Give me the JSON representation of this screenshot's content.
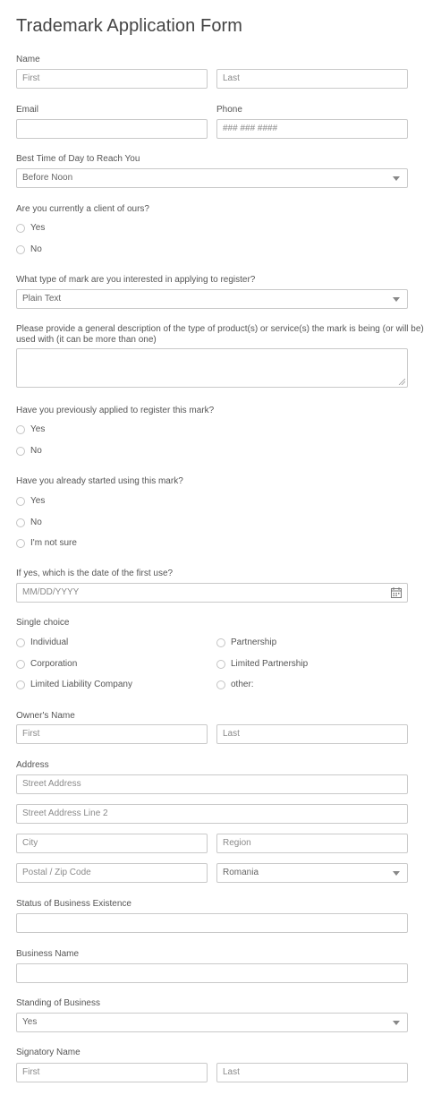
{
  "form": {
    "title": "Trademark Application Form",
    "name": {
      "label": "Name",
      "first_placeholder": "First",
      "last_placeholder": "Last"
    },
    "email": {
      "label": "Email",
      "value": ""
    },
    "phone": {
      "label": "Phone",
      "placeholder": "### ### ####"
    },
    "best_time": {
      "label": "Best Time of Day to Reach You",
      "selected": "Before Noon"
    },
    "current_client": {
      "label": "Are you currently a client of ours?",
      "options": [
        "Yes",
        "No"
      ]
    },
    "mark_type": {
      "label": "What type of mark are you interested in applying to register?",
      "selected": "Plain Text"
    },
    "description": {
      "label_line1": "Please provide a general description of the type of product(s) or service(s) the mark is being (or will be)",
      "label_line2": "used with (it can be more than one)",
      "value": ""
    },
    "previously_applied": {
      "label": "Have you previously applied to register this mark?",
      "options": [
        "Yes",
        "No"
      ]
    },
    "already_using": {
      "label": "Have you already started using this mark?",
      "options": [
        "Yes",
        "No",
        "I'm not sure"
      ]
    },
    "first_use_date": {
      "label": "If yes, which is the date of the first use?",
      "placeholder": "MM/DD/YYYY"
    },
    "single_choice": {
      "label": "Single choice",
      "options": [
        "Individual",
        "Partnership",
        "Corporation",
        "Limited Partnership",
        "Limited Liability Company",
        "other:"
      ]
    },
    "owners_name": {
      "label": "Owner's Name",
      "first_placeholder": "First",
      "last_placeholder": "Last"
    },
    "address": {
      "label": "Address",
      "street_placeholder": "Street Address",
      "street2_placeholder": "Street Address Line 2",
      "city_placeholder": "City",
      "region_placeholder": "Region",
      "postal_placeholder": "Postal / Zip Code",
      "country_selected": "Romania"
    },
    "business_status": {
      "label": "Status of Business Existence",
      "value": ""
    },
    "business_name": {
      "label": "Business Name",
      "value": ""
    },
    "business_standing": {
      "label": "Standing of Business",
      "selected": "Yes"
    },
    "signatory_name": {
      "label": "Signatory Name",
      "first_placeholder": "First",
      "last_placeholder": "Last"
    }
  }
}
